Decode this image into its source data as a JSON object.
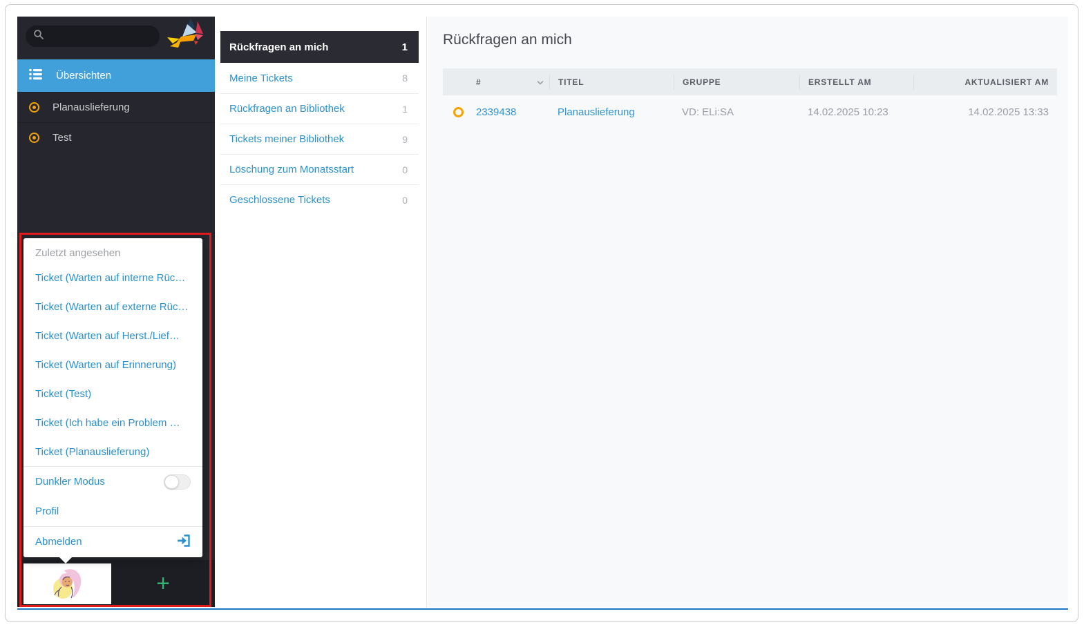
{
  "colors": {
    "accent_blue": "#419fd9",
    "link_blue": "#2b90cc",
    "state_orange": "#f5a300",
    "annotation_red": "#df1b1b",
    "bottom_line_blue": "#1779c8",
    "add_green": "#35b06e",
    "sidebar_dark": "#26272e"
  },
  "sidebar": {
    "search": {
      "placeholder": ""
    },
    "items": [
      {
        "label": "Übersichten"
      },
      {
        "label": "Planauslieferung"
      },
      {
        "label": "Test"
      }
    ],
    "taskbar": {
      "add_label": "+"
    }
  },
  "user_menu": {
    "recent_label": "Zuletzt angesehen",
    "recent_items": [
      {
        "label": "Ticket (Warten auf interne Rüc…"
      },
      {
        "label": "Ticket (Warten auf externe Rüc…"
      },
      {
        "label": "Ticket (Warten auf Herst./Lief…"
      },
      {
        "label": "Ticket (Warten auf Erinnerung)"
      },
      {
        "label": "Ticket (Test)"
      },
      {
        "label": "Ticket (Ich habe ein Problem …"
      },
      {
        "label": "Ticket (Planauslieferung)"
      }
    ],
    "dark_mode_label": "Dunkler Modus",
    "dark_mode_on": false,
    "profile_label": "Profil",
    "logout_label": "Abmelden"
  },
  "overviews": {
    "items": [
      {
        "label": "Rückfragen an mich",
        "count": "1",
        "active": true
      },
      {
        "label": "Meine Tickets",
        "count": "8"
      },
      {
        "label": "Rückfragen an Bibliothek",
        "count": "1"
      },
      {
        "label": "Tickets meiner Bibliothek",
        "count": "9"
      },
      {
        "label": "Löschung zum Monatsstart",
        "count": "0"
      },
      {
        "label": "Geschlossene Tickets",
        "count": "0"
      }
    ]
  },
  "main": {
    "title": "Rückfragen an mich",
    "table": {
      "columns": [
        "#",
        "TITEL",
        "GRUPPE",
        "ERSTELLT AM",
        "AKTUALISIERT AM"
      ],
      "rows": [
        {
          "state": "pending",
          "number": "2339438",
          "title": "Planauslieferung",
          "group": "VD: ELi:SA",
          "created_at": "14.02.2025 10:23",
          "updated_at": "14.02.2025 13:33"
        }
      ]
    }
  }
}
